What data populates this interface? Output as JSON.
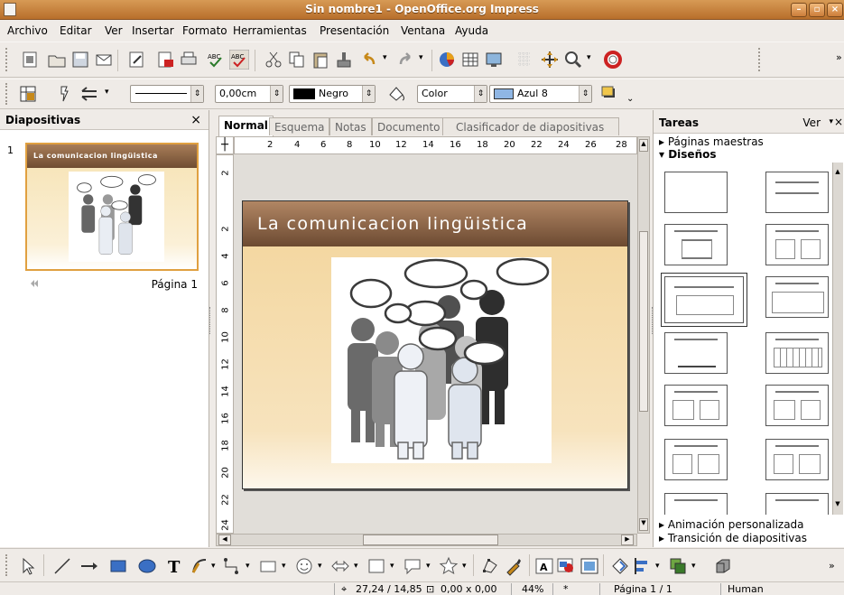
{
  "window": {
    "title": "Sin nombre1 - OpenOffice.org Impress"
  },
  "menu": [
    "Archivo",
    "Editar",
    "Ver",
    "Insertar",
    "Formato",
    "Herramientas",
    "Presentación",
    "Ventana",
    "Ayuda"
  ],
  "line_toolbar": {
    "line_width": "0,00cm",
    "line_color": "Negro",
    "area_style": "Color",
    "area_color": "Azul 8",
    "colors": {
      "line_color_swatch": "#000000",
      "area_color_swatch": "#8fb6e4"
    }
  },
  "slides_panel": {
    "title": "Diapositivas",
    "close": "×",
    "slide_number": "1",
    "thumbnail_title": "La comunicacion lingüistica",
    "page_label": "Página 1"
  },
  "editor": {
    "tabs": [
      "Normal",
      "Esquema",
      "Notas",
      "Documento",
      "Clasificador de diapositivas"
    ],
    "active_tab": "Normal",
    "hruler": [
      "2",
      "4",
      "6",
      "8",
      "10",
      "12",
      "14",
      "16",
      "18",
      "20",
      "22",
      "24",
      "26",
      "28"
    ],
    "vruler": [
      "2",
      "2",
      "4",
      "6",
      "8",
      "10",
      "12",
      "14",
      "16",
      "18",
      "20",
      "22",
      "24"
    ],
    "slide_title": "La comunicacion lingüistica"
  },
  "tasks_panel": {
    "title": "Tareas",
    "view_menu": "Ver",
    "sections": {
      "master_pages": "Páginas maestras",
      "layouts": "Diseños",
      "custom_animation": "Animación personalizada",
      "slide_transition": "Transición de diapositivas"
    },
    "expand_marker": "▸",
    "collapse_marker": "▾"
  },
  "statusbar": {
    "position": "27,24 / 14,85",
    "size": "0,00 x 0,00",
    "zoom": "44%",
    "modified": "*",
    "page": "Página 1 / 1",
    "theme": "Human"
  },
  "colors": {
    "title_bar": "#c67f3c",
    "slide_header": "#7d5638",
    "slide_background": "#f5dcaa",
    "selection": "#e0a040"
  }
}
